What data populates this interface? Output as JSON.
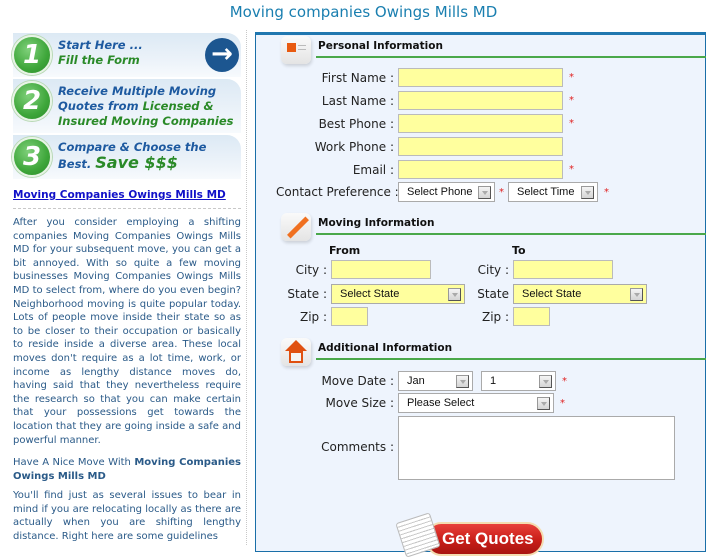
{
  "page": {
    "title": "Moving companies Owings Mills MD"
  },
  "sidebar": {
    "steps": [
      {
        "number": "1",
        "line1": "Start Here ...",
        "line2": "Fill the Form"
      },
      {
        "number": "2",
        "line1": "Receive Multiple Moving",
        "line2a": "Quotes from ",
        "line2b": "Licensed &",
        "line3": "Insured Moving Companies"
      },
      {
        "number": "3",
        "line1": "Compare & Choose the",
        "line2a": "Best. ",
        "line2b": "Save $$$"
      }
    ],
    "arrow_icon": "→",
    "link": "Moving Companies Owings Mills MD",
    "paragraph1": "After you consider employing a shifting companies Moving Companies Owings Mills MD for your subsequent move, you can get a bit annoyed. With so quite a few moving businesses Moving Companies Owings Mills MD to select from, where do you even begin? Neighborhood moving is quite popular today. Lots of people move inside their state so as to be closer to their occupation or basically to reside inside a diverse area. These local moves don't require as a lot time, work, or income as lengthy distance moves do, having said that they nevertheless require the research so that you can make certain that your possessions get towards the location that they are going inside a safe and powerful manner.",
    "heading2_plain": "Have A Nice Move With ",
    "heading2_bold": "Moving Companies Owings Mills MD",
    "paragraph2": "You'll find just as several issues to bear in mind if you are relocating locally as there are actually when you are shifting lengthy distance. Right here are some guidelines"
  },
  "form": {
    "personal": {
      "title": "Personal Information",
      "first_name": "First Name :",
      "last_name": "Last Name :",
      "best_phone": "Best Phone :",
      "work_phone": "Work Phone :",
      "email": "Email :",
      "contact_pref": "Contact Preference :",
      "select_phone": "Select Phone",
      "select_time": "Select Time",
      "required_mark": "*"
    },
    "moving": {
      "title": "Moving Information",
      "from": "From",
      "to": "To",
      "city": "City :",
      "state": "State :",
      "state_to": "State",
      "zip": "Zip :",
      "select_state": "Select State"
    },
    "additional": {
      "title": "Additional Information",
      "move_date": "Move Date :",
      "month": "Jan",
      "day": "1",
      "move_size": "Move Size :",
      "move_size_value": "Please Select",
      "comments": "Comments :"
    },
    "submit": "Get Quotes"
  }
}
